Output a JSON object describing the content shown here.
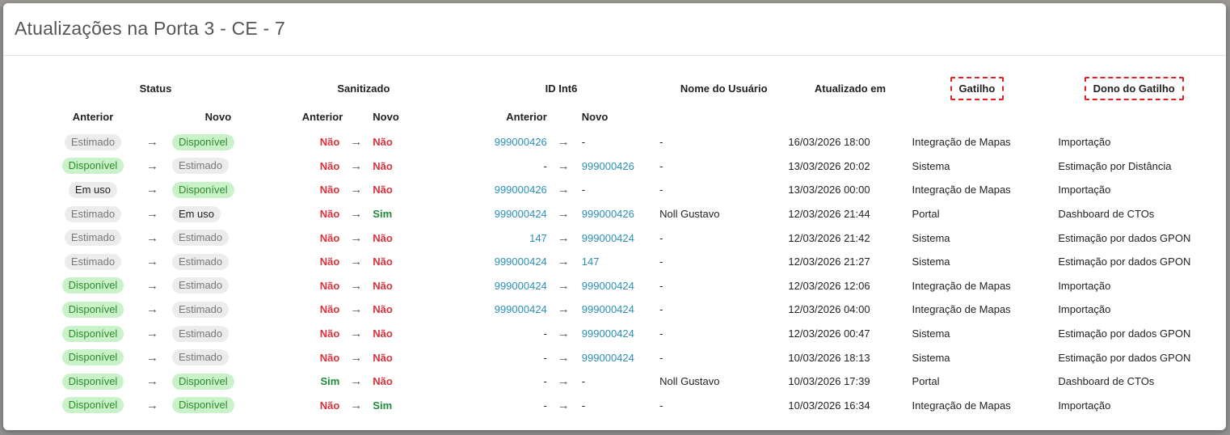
{
  "modal": {
    "title": "Atualizações na Porta 3 - CE - 7"
  },
  "table": {
    "group_headers": {
      "status": "Status",
      "sanitizado": "Sanitizado",
      "id_int6": "ID Int6",
      "user": "Nome do Usuário",
      "updated": "Atualizado em",
      "trigger": "Gatilho",
      "trigger_owner": "Dono do Gatilho"
    },
    "sub_headers": {
      "previous": "Anterior",
      "new": "Novo"
    },
    "arrow": "→",
    "rows": [
      {
        "status_prev": "Estimado",
        "status_new": "Disponível",
        "san_prev": "Não",
        "san_new": "Não",
        "id_prev": "999000426",
        "id_new": "-",
        "user": "-",
        "date": "16/03/2026 18:00",
        "trigger": "Integração de Mapas",
        "owner": "Importação"
      },
      {
        "status_prev": "Disponível",
        "status_new": "Estimado",
        "san_prev": "Não",
        "san_new": "Não",
        "id_prev": "-",
        "id_new": "999000426",
        "user": "-",
        "date": "13/03/2026 20:02",
        "trigger": "Sistema",
        "owner": "Estimação por Distância"
      },
      {
        "status_prev": "Em uso",
        "status_new": "Disponível",
        "san_prev": "Não",
        "san_new": "Não",
        "id_prev": "999000426",
        "id_new": "-",
        "user": "-",
        "date": "13/03/2026 00:00",
        "trigger": "Integração de Mapas",
        "owner": "Importação"
      },
      {
        "status_prev": "Estimado",
        "status_new": "Em uso",
        "san_prev": "Não",
        "san_new": "Sim",
        "id_prev": "999000424",
        "id_new": "999000426",
        "user": "Noll Gustavo",
        "date": "12/03/2026 21:44",
        "trigger": "Portal",
        "owner": "Dashboard de CTOs"
      },
      {
        "status_prev": "Estimado",
        "status_new": "Estimado",
        "san_prev": "Não",
        "san_new": "Não",
        "id_prev": "147",
        "id_new": "999000424",
        "user": "-",
        "date": "12/03/2026 21:42",
        "trigger": "Sistema",
        "owner": "Estimação por dados GPON"
      },
      {
        "status_prev": "Estimado",
        "status_new": "Estimado",
        "san_prev": "Não",
        "san_new": "Não",
        "id_prev": "999000424",
        "id_new": "147",
        "user": "-",
        "date": "12/03/2026 21:27",
        "trigger": "Sistema",
        "owner": "Estimação por dados GPON"
      },
      {
        "status_prev": "Disponível",
        "status_new": "Estimado",
        "san_prev": "Não",
        "san_new": "Não",
        "id_prev": "999000424",
        "id_new": "999000424",
        "user": "-",
        "date": "12/03/2026 12:06",
        "trigger": "Integração de Mapas",
        "owner": "Importação"
      },
      {
        "status_prev": "Disponível",
        "status_new": "Estimado",
        "san_prev": "Não",
        "san_new": "Não",
        "id_prev": "999000424",
        "id_new": "999000424",
        "user": "-",
        "date": "12/03/2026 04:00",
        "trigger": "Integração de Mapas",
        "owner": "Importação"
      },
      {
        "status_prev": "Disponível",
        "status_new": "Estimado",
        "san_prev": "Não",
        "san_new": "Não",
        "id_prev": "-",
        "id_new": "999000424",
        "user": "-",
        "date": "12/03/2026 00:47",
        "trigger": "Sistema",
        "owner": "Estimação por dados GPON"
      },
      {
        "status_prev": "Disponível",
        "status_new": "Estimado",
        "san_prev": "Não",
        "san_new": "Não",
        "id_prev": "-",
        "id_new": "999000424",
        "user": "-",
        "date": "10/03/2026 18:13",
        "trigger": "Sistema",
        "owner": "Estimação por dados GPON"
      },
      {
        "status_prev": "Disponível",
        "status_new": "Disponível",
        "san_prev": "Sim",
        "san_new": "Não",
        "id_prev": "-",
        "id_new": "-",
        "user": "Noll Gustavo",
        "date": "10/03/2026 17:39",
        "trigger": "Portal",
        "owner": "Dashboard de CTOs"
      },
      {
        "status_prev": "Disponível",
        "status_new": "Disponível",
        "san_prev": "Não",
        "san_new": "Sim",
        "id_prev": "-",
        "id_new": "-",
        "user": "-",
        "date": "10/03/2026 16:34",
        "trigger": "Integração de Mapas",
        "owner": "Importação"
      }
    ]
  },
  "colors": {
    "available_bg": "#c9f2c9",
    "available_text": "#2e8a2e",
    "neutral_bg": "#ececec",
    "no_red": "#d9323c",
    "yes_green": "#1e8a3c",
    "id_link": "#2a8fb8",
    "highlight_dashed": "#e32020"
  }
}
